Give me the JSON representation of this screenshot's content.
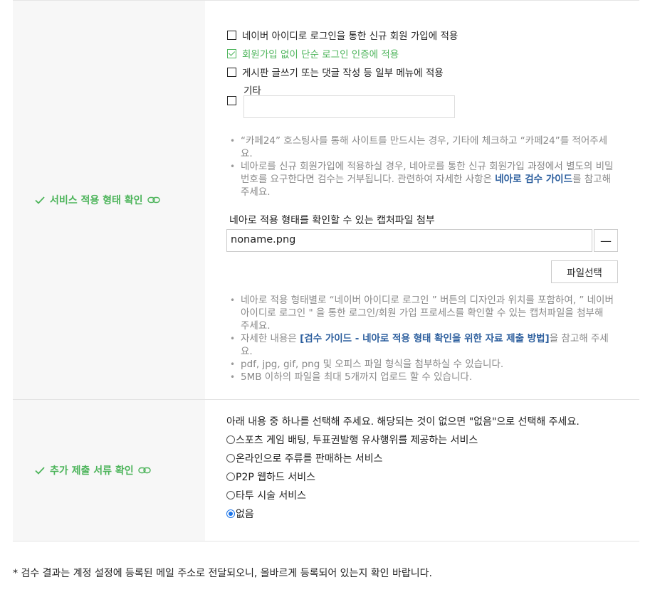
{
  "service_section": {
    "label": "서비스 적용 형태 확인",
    "options": [
      {
        "text": "네이버 아이디로 로그인을 통한 신규 회원 가입에 적용",
        "checked": false
      },
      {
        "text": "회원가입 없이 단순 로그인 인증에 적용",
        "checked": true
      },
      {
        "text": "게시판 글쓰기 또는 댓글 작성 등 일부 메뉴에 적용",
        "checked": false
      }
    ],
    "etc_label": "기타",
    "etc_value": "",
    "notes": {
      "n1": "“카페24” 호스팅사를 통해 사이트를 만드시는 경우, 기타에 체크하고 “카페24”를 적어주세요.",
      "n2_pre": "네아로를 신규 회원가입에 적용하실 경우, 네아로를 통한 신규 회원가입 과정에서 별도의 비밀번호를 요구한다면 검수는 거부됩니다. 관련하여 자세한 사항은 ",
      "n2_link": "네아로 검수 가이드",
      "n2_post": "를 참고해 주세요."
    },
    "attach_title": "네아로 적용 형태를 확인할 수 있는 캡처파일 첨부",
    "file_name": "noname.png",
    "minus_label": "—",
    "file_button": "파일선택",
    "attach_notes": {
      "a1": "네아로 적용 형태별로 “네이버 아이디로 로그인 ” 버튼의 디자인과 위치를 포함하여, ” 네이버 아이디로 로그인 \" 을 통한 로그인/회원 가입 프로세스를 확인할 수 있는 캡처파일을 첨부해 주세요.",
      "a2_pre": "자세한 내용은 ",
      "a2_link": "[검수 가이드 - 네아로 적용 형태 확인을 위한 자료 제출 방법]",
      "a2_post": "을 참고해 주세요.",
      "a3": "pdf, jpg, gif, png 및 오피스 파일 형식을 첨부하실 수 있습니다.",
      "a4": "5MB 이하의 파일을 최대 5개까지 업로드 할 수 있습니다."
    }
  },
  "extra_section": {
    "label": "추가 제출 서류 확인",
    "question": "아래 내용 중 하나를 선택해 주세요. 해당되는 것이 없으면 \"없음\"으로 선택해 주세요.",
    "options": [
      {
        "text": "스포츠 게임 배팅, 투표권발행 유사행위를 제공하는 서비스",
        "selected": false
      },
      {
        "text": "온라인으로 주류를 판매하는 서비스",
        "selected": false
      },
      {
        "text": "P2P 웹하드 서비스",
        "selected": false
      },
      {
        "text": "타투 시술 서비스",
        "selected": false
      },
      {
        "text": "없음",
        "selected": true
      }
    ]
  },
  "footer": "* 검수 결과는 계정 설정에 등록된 메일 주소로 전달되오니, 올바르게 등록되어 있는지 확인 바랍니다.",
  "colors": {
    "accent": "#4cb45a",
    "link": "#2d5f9e",
    "radio": "#1a73e8"
  }
}
